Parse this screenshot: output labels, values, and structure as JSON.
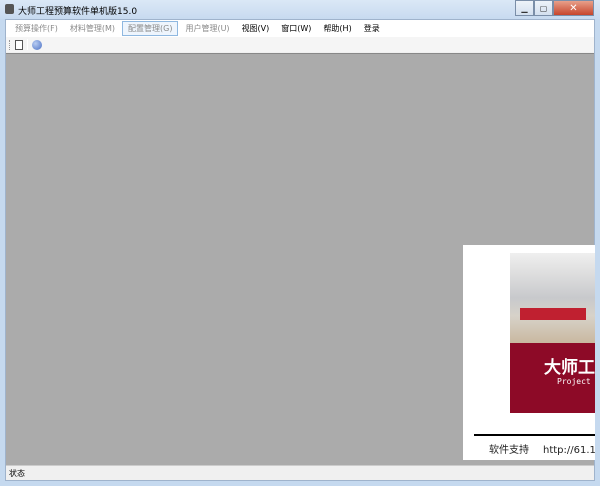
{
  "window": {
    "title": "大师工程预算软件单机版15.0"
  },
  "menu": [
    {
      "label": "预算操作(F)",
      "enabled": false
    },
    {
      "label": "材料管理(M)",
      "enabled": false
    },
    {
      "label": "配置管理(G)",
      "enabled": false,
      "highlighted": true
    },
    {
      "label": "用户管理(U)",
      "enabled": false
    },
    {
      "label": "视图(V)",
      "enabled": true
    },
    {
      "label": "窗口(W)",
      "enabled": true
    },
    {
      "label": "帮助(H)",
      "enabled": true
    },
    {
      "label": "登录",
      "enabled": true
    }
  ],
  "toolbar": [
    "new-document-icon",
    "globe-icon"
  ],
  "splash": {
    "title_zh": "大师工",
    "title_en": "Project",
    "support_label": "软件支持",
    "support_url": "http://61.1"
  },
  "status": {
    "text": "状态"
  },
  "colors": {
    "mdi_bg": "#ababab",
    "brand_red": "#8d0a27"
  }
}
